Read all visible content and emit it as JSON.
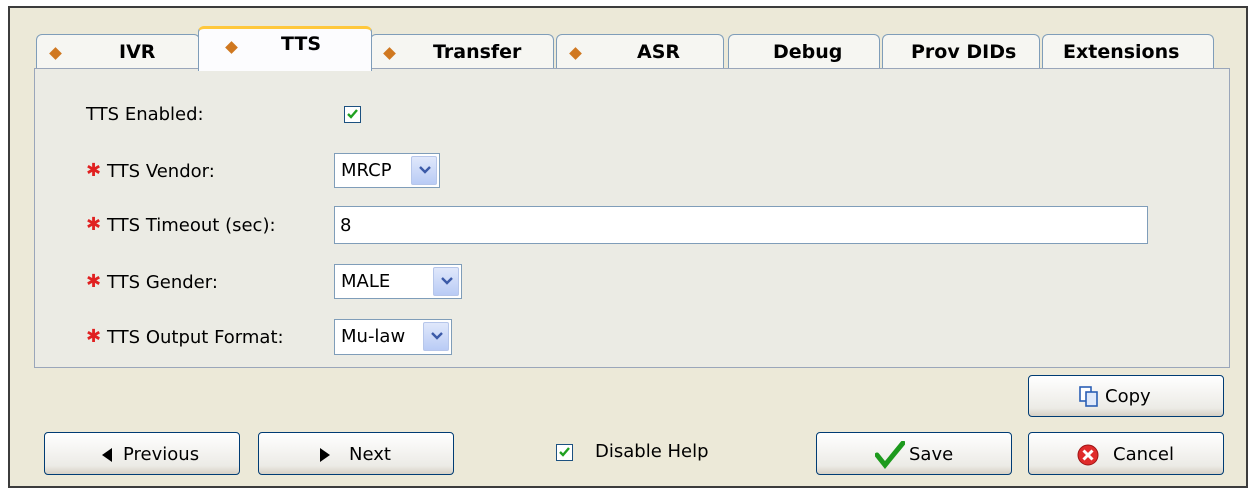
{
  "tabs": [
    {
      "label": "IVR",
      "diamond": true
    },
    {
      "label": "TTS",
      "diamond": true,
      "active": true
    },
    {
      "label": "Transfer",
      "diamond": true
    },
    {
      "label": "ASR",
      "diamond": true
    },
    {
      "label": "Debug",
      "diamond": false
    },
    {
      "label": "Prov DIDs",
      "diamond": false
    },
    {
      "label": "Extensions",
      "diamond": false
    }
  ],
  "form": {
    "tts_enabled": {
      "label": "TTS Enabled:",
      "checked": true
    },
    "required_marker": "✱",
    "tts_vendor": {
      "label": "TTS Vendor:",
      "value": "MRCP"
    },
    "tts_timeout": {
      "label": "TTS Timeout (sec):",
      "value": "8"
    },
    "tts_gender": {
      "label": "TTS Gender:",
      "value": "MALE"
    },
    "tts_output_format": {
      "label": "TTS Output Format:",
      "value": "Mu-law"
    }
  },
  "buttons": {
    "copy": "Copy",
    "previous": "Previous",
    "next": "Next",
    "disable_help": "Disable Help",
    "save": "Save",
    "cancel": "Cancel"
  },
  "colors": {
    "accent": "#ffc83c",
    "diamond": "#d07820",
    "required": "#e02020",
    "border": "#003c74"
  }
}
